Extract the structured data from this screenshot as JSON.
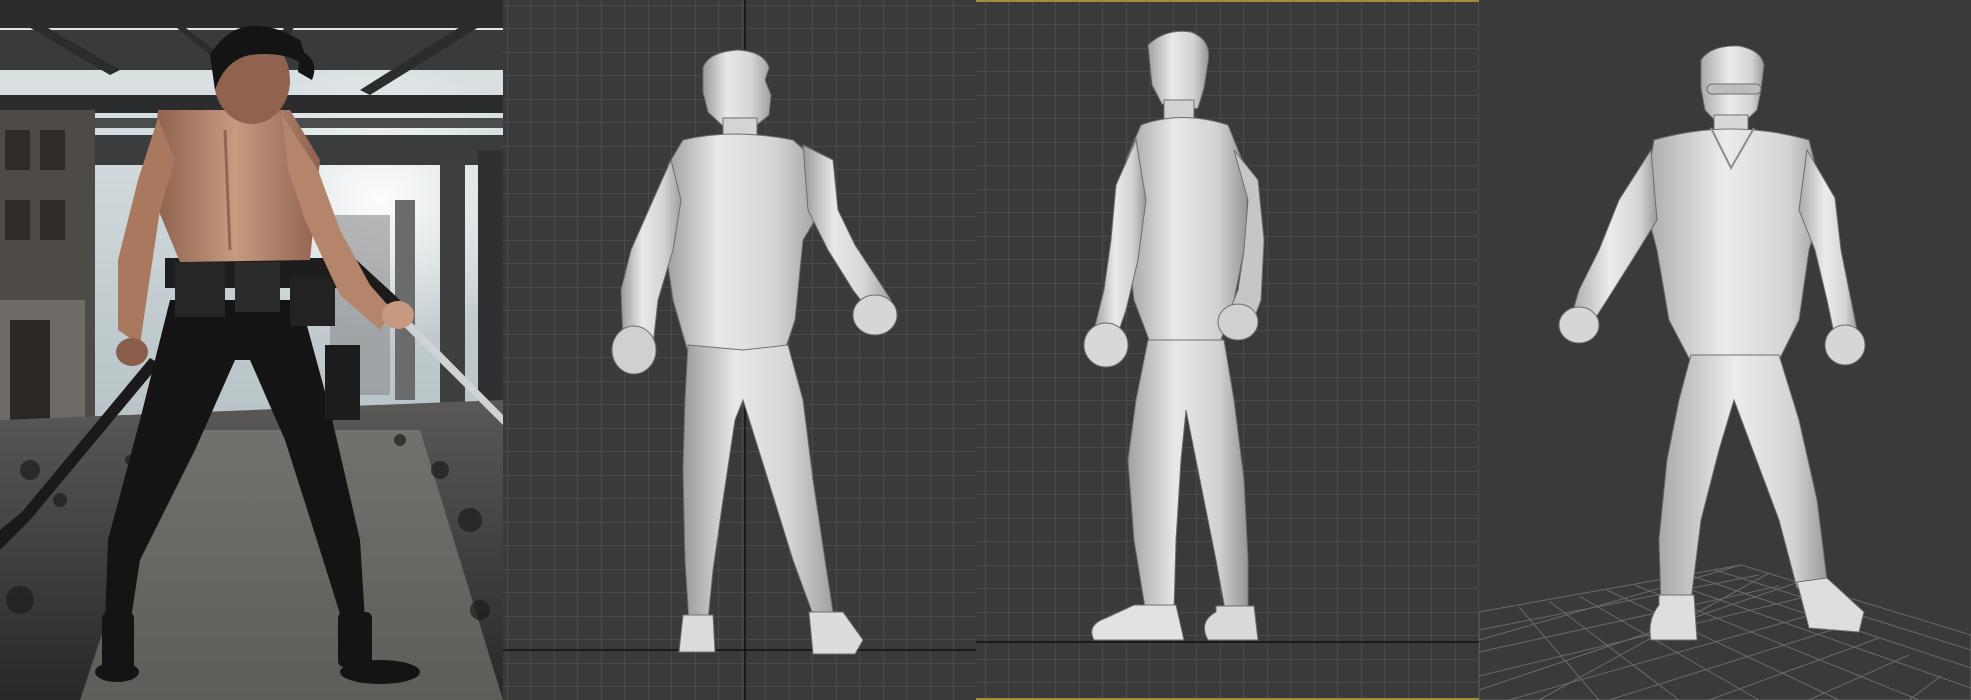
{
  "colors": {
    "viewport_bg": "#3a3a3a",
    "grid_minor": "#5a5a5a",
    "grid_axis": "#111111",
    "model_light": "#e6e6e6",
    "model_mid": "#bdbdbd",
    "model_shadow": "#8c8c8c",
    "selection_border": "#a38b3a",
    "photo_pants": "#121212",
    "photo_skin": "#c08d73"
  },
  "panels": [
    {
      "id": "reference-photo",
      "kind": "photo",
      "description_icon": "reference-photo-icon"
    },
    {
      "id": "back-view",
      "kind": "orthographic-viewport",
      "description_icon": "back-orthographic-icon"
    },
    {
      "id": "side-view",
      "kind": "orthographic-viewport",
      "description_icon": "side-orthographic-icon"
    },
    {
      "id": "perspective-view",
      "kind": "perspective-viewport",
      "description_icon": "perspective-icon"
    }
  ]
}
